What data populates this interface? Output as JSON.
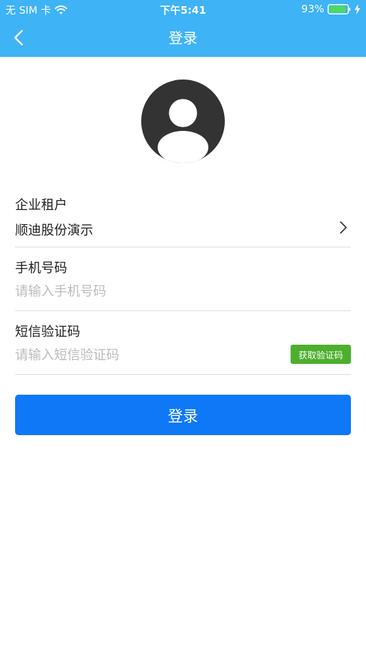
{
  "status_bar": {
    "carrier": "无 SIM 卡",
    "time": "下午5:41",
    "battery": "93%",
    "battery_level": 0.93,
    "battery_color": "#4cd964"
  },
  "nav": {
    "title": "登录",
    "back_icon": "chevron-left-icon"
  },
  "avatar": {
    "icon": "user-avatar-icon",
    "color": "#333333"
  },
  "form": {
    "tenant": {
      "label": "企业租户",
      "value": "顺迪股份演示",
      "icon": "chevron-right-icon"
    },
    "phone": {
      "label": "手机号码",
      "value": "",
      "placeholder": "请输入手机号码"
    },
    "sms": {
      "label": "短信验证码",
      "value": "",
      "placeholder": "请输入短信验证码",
      "get_code_label": "获取验证码",
      "button_color": "#4caf2d"
    }
  },
  "login_button": {
    "label": "登录",
    "color": "#0f78f6"
  },
  "colors": {
    "header": "#3eb3f6",
    "divider": "#dcdcdc"
  }
}
